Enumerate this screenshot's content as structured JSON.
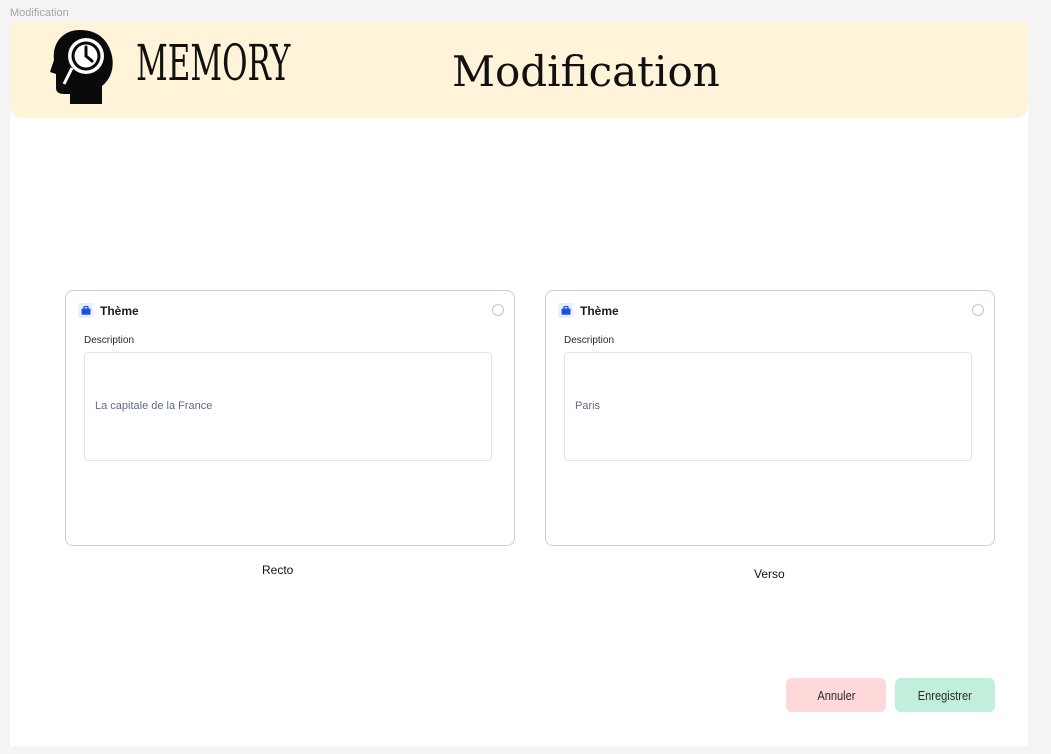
{
  "frame_label": "Modification",
  "header": {
    "logo_text": "MEMORY",
    "title": "Modification"
  },
  "cards": [
    {
      "title": "Thème",
      "description_label": "Description",
      "value": "La capitale de la France",
      "caption": "Recto"
    },
    {
      "title": "Thème",
      "description_label": "Description",
      "value": "Paris",
      "caption": "Verso"
    }
  ],
  "buttons": {
    "cancel_label": "Annuler",
    "save_label": "Enregistrer"
  },
  "icons": {
    "logo": "head-clock-icon",
    "card_badge": "briefcase-icon"
  },
  "colors": {
    "header_bg": "#fff3d9",
    "card_border": "#c8cde4",
    "badge_icon": "#1f4fe0",
    "cancel_bg": "#ffd9d9",
    "save_bg": "#c2efdb"
  }
}
